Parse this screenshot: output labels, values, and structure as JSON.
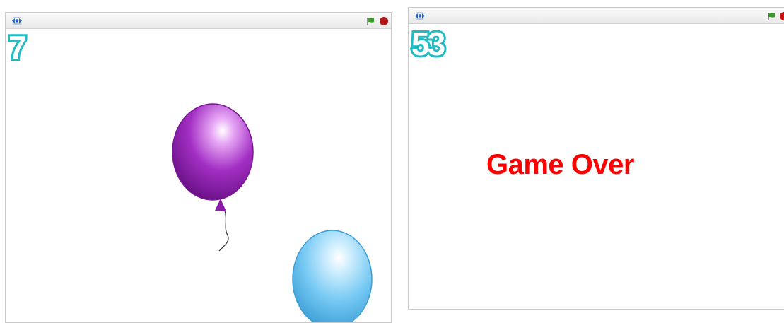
{
  "colors": {
    "score": "#1fbcc4",
    "game_over": "#ff0000",
    "balloon_purple": "#9b1fb8",
    "balloon_blue": "#6cc4f2",
    "stop": "#b01818",
    "flag": "#3a9a2a"
  },
  "left_stage": {
    "score": "7",
    "icons": [
      "presentation-mode-icon",
      "green-flag-icon",
      "stop-icon"
    ]
  },
  "right_stage": {
    "score": "53",
    "message": "Game Over",
    "icons": [
      "presentation-mode-icon",
      "green-flag-icon",
      "stop-icon"
    ]
  }
}
